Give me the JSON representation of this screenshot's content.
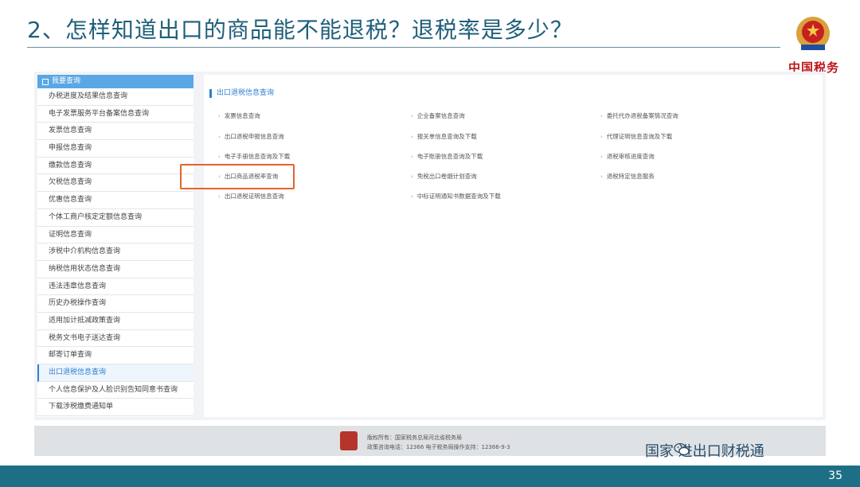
{
  "slide": {
    "title": "2、怎样知道出口的商品能不能退税？退税率是多少？",
    "logo_text": "中国税务",
    "page_number": "35",
    "watermark": "国家  进出口财税通"
  },
  "sidebar": {
    "header": "我要查询",
    "items": [
      {
        "label": "办税进度及结果信息查询"
      },
      {
        "label": "电子发票服务平台备案信息查询"
      },
      {
        "label": "发票信息查询"
      },
      {
        "label": "申报信息查询"
      },
      {
        "label": "缴款信息查询"
      },
      {
        "label": "欠税信息查询"
      },
      {
        "label": "优惠信息查询"
      },
      {
        "label": "个体工商户核定定额信息查询"
      },
      {
        "label": "证明信息查询"
      },
      {
        "label": "涉税中介机构信息查询"
      },
      {
        "label": "纳税信用状态信息查询"
      },
      {
        "label": "违法违章信息查询"
      },
      {
        "label": "历史办税操作查询"
      },
      {
        "label": "适用加计抵减政策查询"
      },
      {
        "label": "税务文书电子送达查询"
      },
      {
        "label": "邮寄订单查询"
      },
      {
        "label": "出口退税信息查询"
      },
      {
        "label": "个人信息保护及人脸识别告知同意书查询"
      },
      {
        "label": "下载涉税缴费通知单"
      }
    ]
  },
  "content": {
    "section_title": "出口退税信息查询",
    "items": [
      {
        "label": "发票信息查询"
      },
      {
        "label": "企业备案信息查询"
      },
      {
        "label": "委托代办退税备案情况查询"
      },
      {
        "label": "出口退税申报信息查询"
      },
      {
        "label": "报关单信息查询及下载"
      },
      {
        "label": "代理证明信息查询及下载"
      },
      {
        "label": "电子手册信息查询及下载"
      },
      {
        "label": "电子账册信息查询及下载"
      },
      {
        "label": "退税审核进度查询"
      },
      {
        "label": "出口商品退税率查询"
      },
      {
        "label": "免税出口卷烟计划查询"
      },
      {
        "label": "退税特定信息服务"
      },
      {
        "label": "出口退税证明信息查询"
      },
      {
        "label": "中标证明通知书数据查询及下载"
      }
    ]
  },
  "footer": {
    "line1": "版权所有：国家税务总局河北省税务局",
    "line2": "政策咨询电话：12366  电子税务局操作支持：12366-9-3"
  },
  "colors": {
    "title": "#1f5f7a",
    "accent_blue": "#2f7fd0",
    "sidebar_header": "#5aa7e6",
    "highlight": "#e5632a",
    "bottom_bar": "#1e6f86"
  }
}
